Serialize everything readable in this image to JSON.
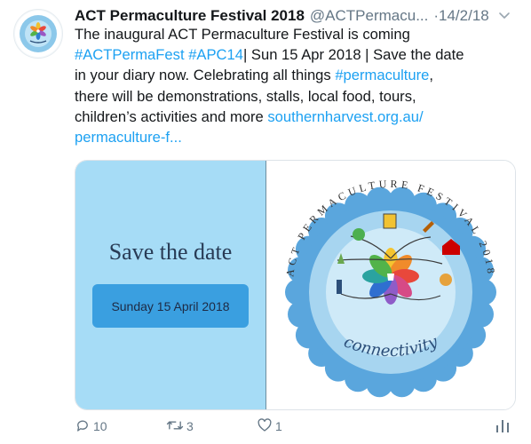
{
  "tweet": {
    "author_name": "ACT Permaculture Festival 2018",
    "author_handle": "@ACTPermacu...",
    "timestamp": "·14/2/18",
    "text_lines": [
      [
        {
          "t": "The inaugural ACT Permaculture Festival is coming",
          "link": false
        }
      ],
      [
        {
          "t": "#ACTPermaFest",
          "link": true
        },
        {
          "t": " ",
          "link": false
        },
        {
          "t": "#APC14",
          "link": true
        },
        {
          "t": "| Sun 15 Apr 2018 | Save the date",
          "link": false
        }
      ],
      [
        {
          "t": "in your diary now. Celebrating all things ",
          "link": false
        },
        {
          "t": "#permaculture",
          "link": true
        },
        {
          "t": ",",
          "link": false
        }
      ],
      [
        {
          "t": "there will be demonstrations, stalls, local food, tours,",
          "link": false
        }
      ],
      [
        {
          "t": "children’s activities and more ",
          "link": false
        },
        {
          "t": "southernharvest.org.au/",
          "link": true
        }
      ],
      [
        {
          "t": "permaculture-f...",
          "link": true
        }
      ]
    ]
  },
  "media": {
    "save_title": "Save the date",
    "date_button": "Sunday 15 April 2018",
    "logo_arc_text": "ACT PERMACULTURE FESTIVAL 2018",
    "logo_word": "connectivity"
  },
  "actions": {
    "reply_count": "10",
    "retweet_count": "3",
    "like_count": "1"
  },
  "colors": {
    "link": "#1da1f2",
    "panel_blue": "#a6dcf6",
    "button_blue": "#3a9fe0",
    "muted": "#657786"
  }
}
